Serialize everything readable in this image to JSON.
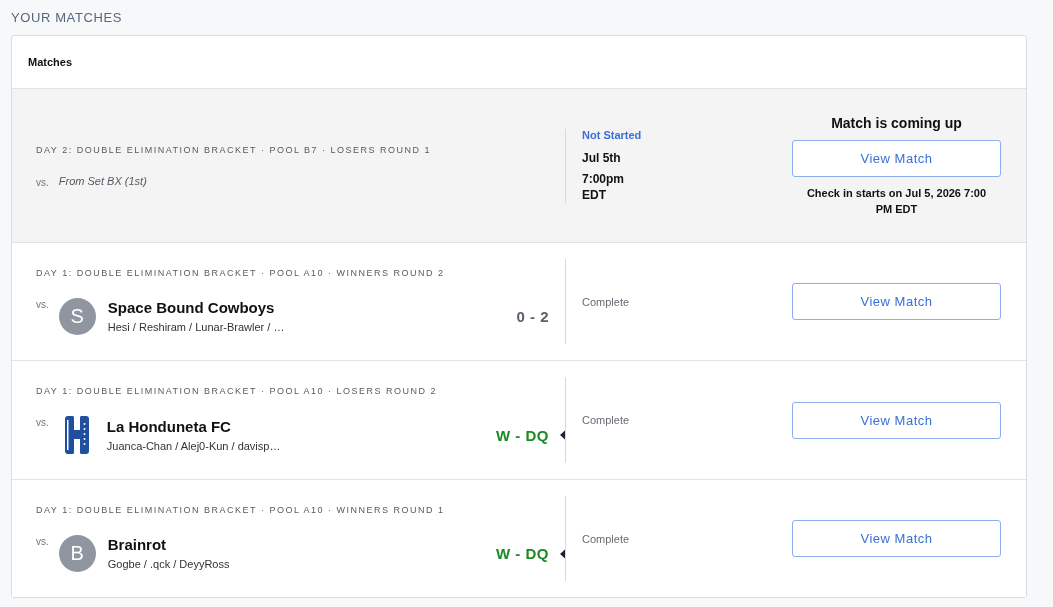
{
  "section_title": "YOUR MATCHES",
  "panel": {
    "title": "Matches"
  },
  "matches": [
    {
      "kind": "upcoming",
      "round": "DAY 2: DOUBLE ELIMINATION BRACKET · POOL B7 · LOSERS ROUND 1",
      "vs": "vs.",
      "opponent": {
        "kind": "pending",
        "name": "From Set BX (1st)"
      },
      "status": "Not Started",
      "date": "Jul 5th",
      "time": "7:00pm EDT",
      "notice": "Match is coming up",
      "button": "View Match",
      "check_in": "Check in starts on Jul 5, 2026 7:00 PM EDT"
    },
    {
      "kind": "complete",
      "round": "DAY 1: DOUBLE ELIMINATION BRACKET · POOL A10 · WINNERS ROUND 2",
      "vs": "vs.",
      "opponent": {
        "kind": "team",
        "avatar": {
          "kind": "initial",
          "letter": "S"
        },
        "name": "Space Bound Cowboys",
        "players": "Hesi / Reshiram / Lunar-Brawler / …"
      },
      "score": "0 - 2",
      "won": false,
      "status": "Complete",
      "button": "View Match"
    },
    {
      "kind": "complete",
      "round": "DAY 1: DOUBLE ELIMINATION BRACKET · POOL A10 · LOSERS ROUND 2",
      "vs": "vs.",
      "opponent": {
        "kind": "team",
        "avatar": {
          "kind": "logo"
        },
        "name": "La Honduneta FC",
        "players": "Juanca-Chan / Alej0-Kun / davisp…"
      },
      "score": "W - DQ",
      "won": true,
      "status": "Complete",
      "button": "View Match"
    },
    {
      "kind": "complete",
      "round": "DAY 1: DOUBLE ELIMINATION BRACKET · POOL A10 · WINNERS ROUND 1",
      "vs": "vs.",
      "opponent": {
        "kind": "team",
        "avatar": {
          "kind": "initial",
          "letter": "B"
        },
        "name": "Brainrot",
        "players": "Gogbe / .qck / DeyyRoss"
      },
      "score": "W - DQ",
      "won": true,
      "status": "Complete",
      "button": "View Match"
    }
  ]
}
